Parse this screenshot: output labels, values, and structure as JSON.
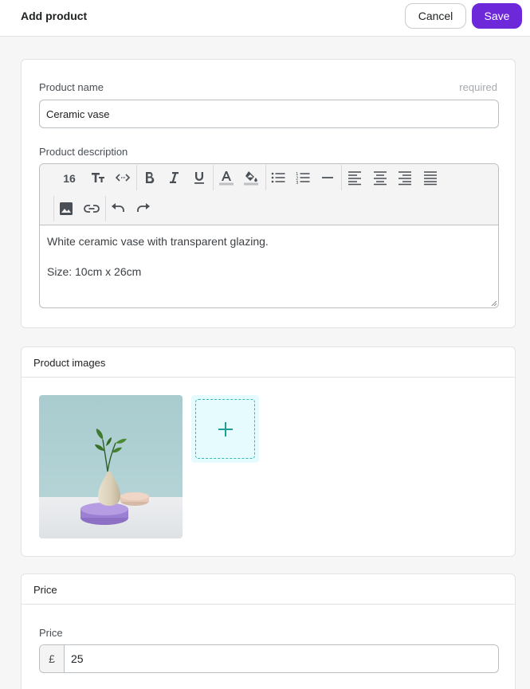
{
  "header": {
    "title": "Add product",
    "cancel_label": "Cancel",
    "save_label": "Save"
  },
  "details": {
    "name_label": "Product name",
    "name_hint": "required",
    "name_value": "Ceramic vase",
    "description_label": "Product description",
    "toolbar": {
      "font_size": "16",
      "icons": [
        "text-size-icon",
        "code-icon",
        "bold-icon",
        "italic-icon",
        "underline-icon",
        "font-color-icon",
        "fill-color-icon",
        "bullet-list-icon",
        "numbered-list-icon",
        "horizontal-rule-icon",
        "align-left-icon",
        "align-center-icon",
        "align-right-icon",
        "align-justify-icon",
        "image-icon",
        "link-icon",
        "undo-icon",
        "redo-icon"
      ]
    },
    "description_lines": [
      "White ceramic vase with transparent glazing.",
      "Size: 10cm x 26cm"
    ]
  },
  "images": {
    "header": "Product images",
    "add_icon": "plus-icon"
  },
  "price": {
    "header": "Price",
    "label": "Price",
    "currency": "£",
    "value": "25"
  },
  "colors": {
    "accent": "#6d28d9",
    "add_tile_bg": "#e6fbfd",
    "add_tile_border": "#39b7b2"
  }
}
